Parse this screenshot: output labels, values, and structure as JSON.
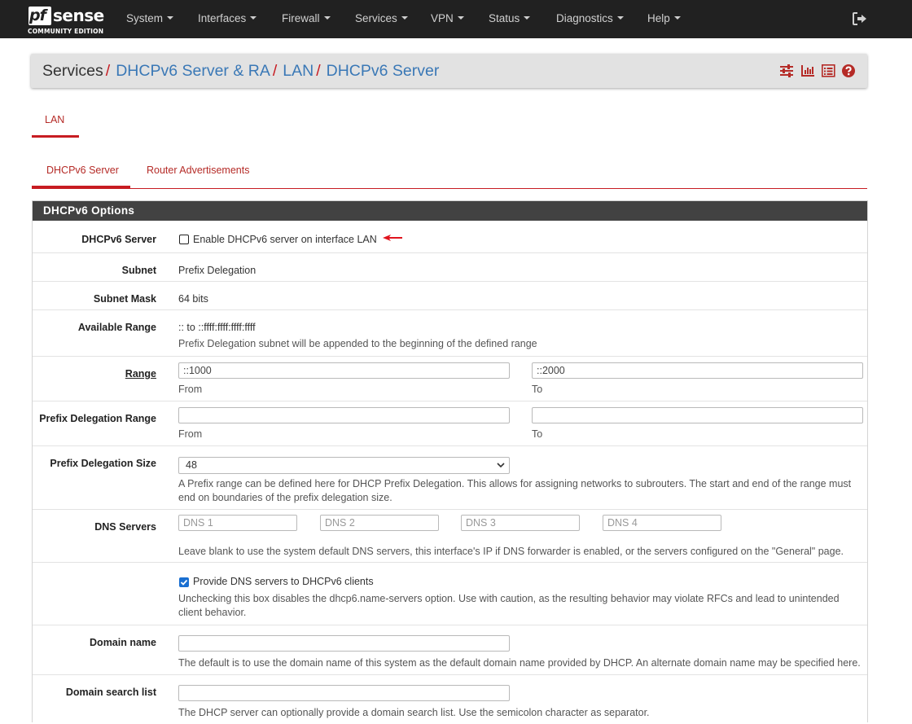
{
  "logo": {
    "text_pf": "pf",
    "text_sense": "sense",
    "edition": "COMMUNITY EDITION"
  },
  "nav": {
    "items": [
      "System",
      "Interfaces",
      "Firewall",
      "Services",
      "VPN",
      "Status",
      "Diagnostics",
      "Help"
    ],
    "logout_icon": "sign-out-icon"
  },
  "breadcrumb": {
    "root": "Services",
    "separator": "/",
    "links": [
      "DHCPv6 Server & RA",
      "LAN",
      "DHCPv6 Server"
    ],
    "icons": [
      "sliders-icon",
      "bar-chart-icon",
      "list-icon",
      "help-circle-icon"
    ]
  },
  "interface_tabs": {
    "active": "LAN"
  },
  "sub_tabs": [
    "DHCPv6 Server",
    "Router Advertisements"
  ],
  "panel": {
    "title": "DHCPv6 Options",
    "dhcpv6_server": {
      "label": "DHCPv6 Server",
      "checkbox_label": "Enable DHCPv6 server on interface LAN",
      "checked": false
    },
    "subnet": {
      "label": "Subnet",
      "value": "Prefix Delegation"
    },
    "subnet_mask": {
      "label": "Subnet Mask",
      "value": "64 bits"
    },
    "available_range": {
      "label": "Available Range",
      "value": ":: to ::ffff:ffff:ffff:ffff",
      "help": "Prefix Delegation subnet will be appended to the beginning of the defined range"
    },
    "range": {
      "label": "Range",
      "from_value": "::1000",
      "to_value": "::2000",
      "from_label": "From",
      "to_label": "To"
    },
    "pd_range": {
      "label": "Prefix Delegation Range",
      "from_value": "",
      "to_value": "",
      "from_label": "From",
      "to_label": "To"
    },
    "pd_size": {
      "label": "Prefix Delegation Size",
      "selected": "48",
      "help": "A Prefix range can be defined here for DHCP Prefix Delegation. This allows for assigning networks to subrouters. The start and end of the range must end on boundaries of the prefix delegation size."
    },
    "dns_servers": {
      "label": "DNS Servers",
      "placeholders": [
        "DNS 1",
        "DNS 2",
        "DNS 3",
        "DNS 4"
      ],
      "help": "Leave blank to use the system default DNS servers, this interface's IP if DNS forwarder is enabled, or the servers configured on the \"General\" page."
    },
    "provide_dns": {
      "checkbox_label": "Provide DNS servers to DHCPv6 clients",
      "checked": true,
      "help": "Unchecking this box disables the dhcp6.name-servers option. Use with caution, as the resulting behavior may violate RFCs and lead to unintended client behavior."
    },
    "domain_name": {
      "label": "Domain name",
      "value": "",
      "help": "The default is to use the domain name of this system as the default domain name provided by DHCP. An alternate domain name may be specified here."
    },
    "domain_search": {
      "label": "Domain search list",
      "value": "",
      "help": "The DHCP server can optionally provide a domain search list. Use the semicolon character as separator."
    }
  },
  "colors": {
    "accent": "#c71c22",
    "link": "#3a78b6",
    "navbar": "#212121",
    "panel_header": "#424242"
  }
}
